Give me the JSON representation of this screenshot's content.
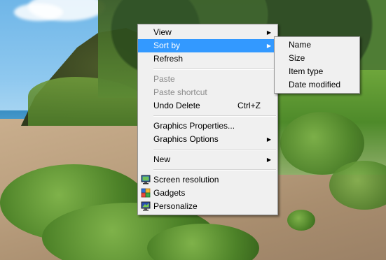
{
  "context_menu": {
    "view": "View",
    "sort_by": "Sort by",
    "refresh": "Refresh",
    "paste": "Paste",
    "paste_shortcut": "Paste shortcut",
    "undo_delete": "Undo Delete",
    "undo_delete_shortcut": "Ctrl+Z",
    "graphics_properties": "Graphics Properties...",
    "graphics_options": "Graphics Options",
    "new": "New",
    "screen_resolution": "Screen resolution",
    "gadgets": "Gadgets",
    "personalize": "Personalize"
  },
  "sort_submenu": {
    "name": "Name",
    "size": "Size",
    "item_type": "Item type",
    "date_modified": "Date modified"
  },
  "colors": {
    "highlight": "#3399ff",
    "menu_bg": "#f0f0f0",
    "disabled_text": "#8b8b8b"
  },
  "icons": {
    "screen_resolution": "monitor-icon",
    "gadgets": "gadgets-icon",
    "personalize": "personalize-icon"
  }
}
